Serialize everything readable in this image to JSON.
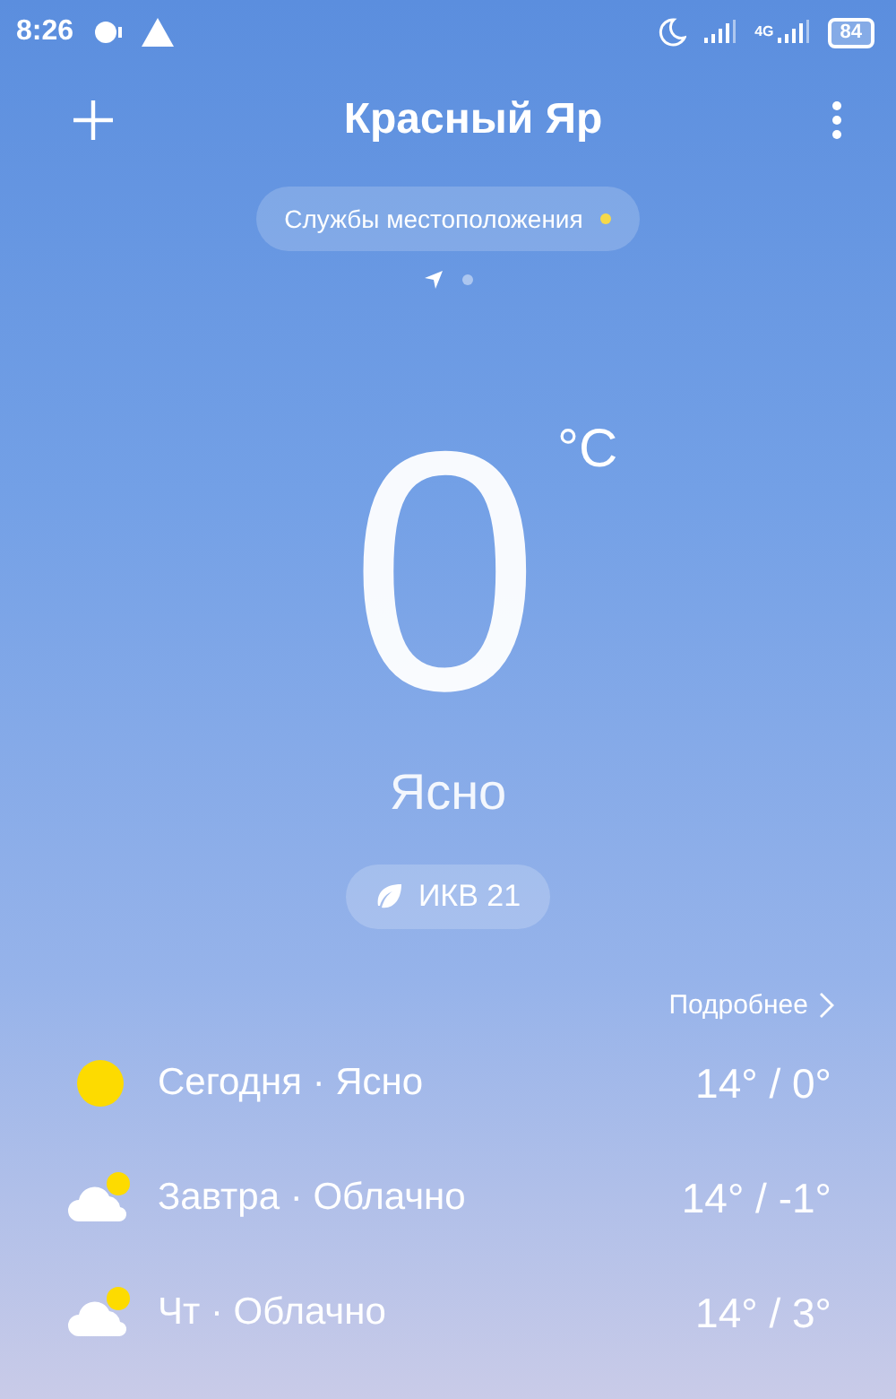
{
  "status_bar": {
    "time": "8:26",
    "network": "4G",
    "battery": "84"
  },
  "header": {
    "title": "Красный Яр"
  },
  "location_pill": {
    "label": "Службы местоположения",
    "color": "#f5d94a"
  },
  "pages": [
    {
      "kind": "location",
      "selected": true
    },
    {
      "kind": "dot",
      "selected": false
    }
  ],
  "current": {
    "temperature": "0",
    "unit": "°C",
    "condition": "Ясно",
    "aqi": "ИКВ 21"
  },
  "more_link": "Подробнее",
  "forecast": [
    {
      "kind": "sun",
      "label": "Сегодня · Ясно",
      "temps": "14° / 0°"
    },
    {
      "kind": "partly_cloudy",
      "label": "Завтра · Облачно",
      "temps": "14° / -1°"
    },
    {
      "kind": "partly_cloudy",
      "label": "Чт · Облачно",
      "temps": "14° / 3°"
    }
  ]
}
